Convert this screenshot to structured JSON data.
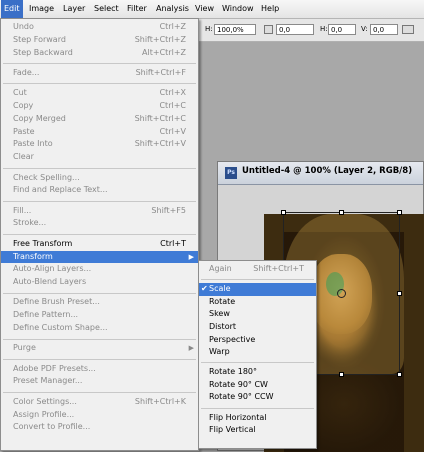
{
  "menubar": [
    "Edit",
    "Image",
    "Layer",
    "Select",
    "Filter",
    "Analysis",
    "View",
    "Window",
    "Help"
  ],
  "options": {
    "h_label": "H:",
    "h_value": "100,0%",
    "angle_value": "0,0",
    "h_skew_label": "H:",
    "h_skew_value": "0,0",
    "v_label": "V:",
    "v_value": "0,0"
  },
  "document": {
    "title": "Untitled-4 @ 100% (Layer 2, RGB/8)",
    "icon": "Ps"
  },
  "edit_menu": [
    {
      "label": "Undo",
      "shortcut": "Ctrl+Z",
      "disabled": true
    },
    {
      "label": "Step Forward",
      "shortcut": "Shift+Ctrl+Z",
      "disabled": true
    },
    {
      "label": "Step Backward",
      "shortcut": "Alt+Ctrl+Z",
      "disabled": true
    },
    {
      "sep": true
    },
    {
      "label": "Fade...",
      "shortcut": "Shift+Ctrl+F",
      "disabled": true
    },
    {
      "sep": true
    },
    {
      "label": "Cut",
      "shortcut": "Ctrl+X",
      "disabled": true
    },
    {
      "label": "Copy",
      "shortcut": "Ctrl+C",
      "disabled": true
    },
    {
      "label": "Copy Merged",
      "shortcut": "Shift+Ctrl+C",
      "disabled": true
    },
    {
      "label": "Paste",
      "shortcut": "Ctrl+V",
      "disabled": true
    },
    {
      "label": "Paste Into",
      "shortcut": "Shift+Ctrl+V",
      "disabled": true
    },
    {
      "label": "Clear",
      "shortcut": "",
      "disabled": true
    },
    {
      "sep": true
    },
    {
      "label": "Check Spelling...",
      "shortcut": "",
      "disabled": true
    },
    {
      "label": "Find and Replace Text...",
      "shortcut": "",
      "disabled": true
    },
    {
      "sep": true
    },
    {
      "label": "Fill...",
      "shortcut": "Shift+F5",
      "disabled": true
    },
    {
      "label": "Stroke...",
      "shortcut": "",
      "disabled": true
    },
    {
      "sep": true
    },
    {
      "label": "Free Transform",
      "shortcut": "Ctrl+T",
      "disabled": false
    },
    {
      "label": "Transform",
      "shortcut": "",
      "disabled": false,
      "highlight": true,
      "submenu": true
    },
    {
      "label": "Auto-Align Layers...",
      "shortcut": "",
      "disabled": true
    },
    {
      "label": "Auto-Blend Layers",
      "shortcut": "",
      "disabled": true
    },
    {
      "sep": true
    },
    {
      "label": "Define Brush Preset...",
      "shortcut": "",
      "disabled": true
    },
    {
      "label": "Define Pattern...",
      "shortcut": "",
      "disabled": true
    },
    {
      "label": "Define Custom Shape...",
      "shortcut": "",
      "disabled": true
    },
    {
      "sep": true
    },
    {
      "label": "Purge",
      "shortcut": "",
      "disabled": true,
      "submenu": true
    },
    {
      "sep": true
    },
    {
      "label": "Adobe PDF Presets...",
      "shortcut": "",
      "disabled": true
    },
    {
      "label": "Preset Manager...",
      "shortcut": "",
      "disabled": true
    },
    {
      "sep": true
    },
    {
      "label": "Color Settings...",
      "shortcut": "Shift+Ctrl+K",
      "disabled": true
    },
    {
      "label": "Assign Profile...",
      "shortcut": "",
      "disabled": true
    },
    {
      "label": "Convert to Profile...",
      "shortcut": "",
      "disabled": true
    }
  ],
  "transform_menu": [
    {
      "label": "Again",
      "shortcut": "Shift+Ctrl+T",
      "disabled": true
    },
    {
      "sep": true
    },
    {
      "label": "Scale",
      "checked": true,
      "highlight": true
    },
    {
      "label": "Rotate"
    },
    {
      "label": "Skew"
    },
    {
      "label": "Distort"
    },
    {
      "label": "Perspective"
    },
    {
      "label": "Warp"
    },
    {
      "sep": true
    },
    {
      "label": "Rotate 180°"
    },
    {
      "label": "Rotate 90° CW"
    },
    {
      "label": "Rotate 90° CCW"
    },
    {
      "sep": true
    },
    {
      "label": "Flip Horizontal"
    },
    {
      "label": "Flip Vertical"
    }
  ]
}
